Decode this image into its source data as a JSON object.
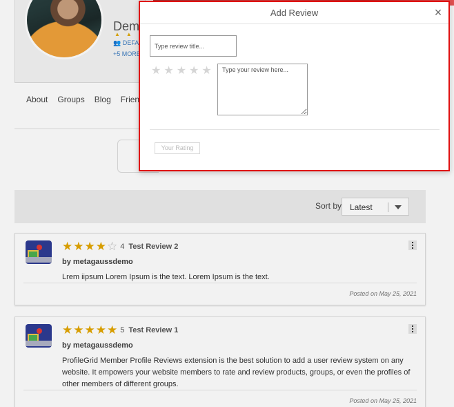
{
  "colors": {
    "accent_red": "#e01010",
    "star_gold": "#e3a600",
    "link_blue": "#3b7bbf"
  },
  "profile": {
    "name_partial": "Dem",
    "group_partial": "DEFA",
    "more_partial": "+5 MORE"
  },
  "tabs": [
    "About",
    "Groups",
    "Blog",
    "Frien"
  ],
  "sort": {
    "label": "Sort by",
    "selected": "Latest"
  },
  "reviews": [
    {
      "rating": 4,
      "rating_label": "4",
      "title": "Test Review 2",
      "author": "by metagaussdemo",
      "text": "Lrem iipsum Lorem Ipsum is the text. Lorem Ipsum is the text.",
      "date": "Posted on May 25, 2021"
    },
    {
      "rating": 5,
      "rating_label": "5",
      "title": "Test Review 1",
      "author": "by metagaussdemo",
      "text": "ProfileGrid Member Profile Reviews extension is the best solution to add a user review system on any website.  It empowers your website members to rate and review products, groups, or even the profiles of other members of different groups.",
      "date": "Posted on May 25, 2021"
    }
  ],
  "modal": {
    "title": "Add Review",
    "close_glyph": "×",
    "title_placeholder": "Type review title...",
    "body_placeholder": "Type your review here...",
    "rating_button": "Your Rating",
    "star_count": 5
  }
}
